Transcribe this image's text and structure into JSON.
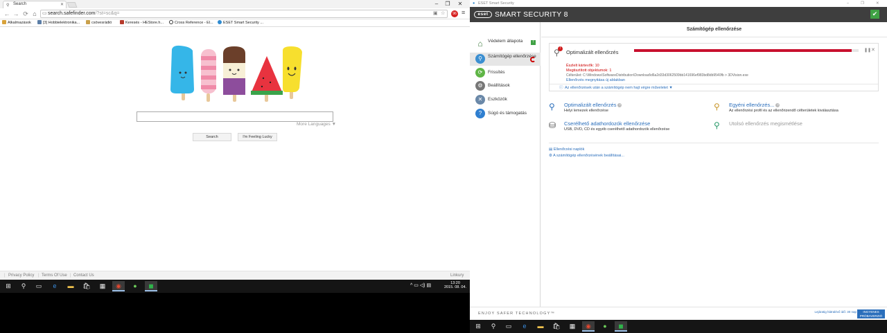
{
  "browser": {
    "tab_title": "Search",
    "url_host": "search.safefinder.com",
    "url_path": "/?st=sc&q=",
    "bookmarks": [
      "Alkalmazások",
      "[3] Hobbielektronika...",
      "csövesrádió",
      "Keresés - HEStore.h...",
      "Cross Reference - El...",
      "ESET Smart Security ..."
    ],
    "ext_badge": "96",
    "more_languages": "More Languages ▼",
    "search_button": "Search",
    "lucky_button": "I'm Feeling Lucky",
    "footer_links": [
      "Privacy Policy",
      "Terms Of Use",
      "Contact Us"
    ],
    "footer_right": "Linkury"
  },
  "taskbar_left": {
    "time": "13:20",
    "date": "2015. 08. 04."
  },
  "eset": {
    "titlebar": "ESET Smart Security",
    "logo": "eset",
    "product": "SMART SECURITY 8",
    "sidebar": [
      {
        "label": "Védelem állapota",
        "icon": "home-icon",
        "badge": "!"
      },
      {
        "label": "Számítógép ellenőrzése",
        "icon": "magnifier-icon"
      },
      {
        "label": "Frissítés",
        "icon": "refresh-icon"
      },
      {
        "label": "Beállítások",
        "icon": "gear-icon"
      },
      {
        "label": "Eszközök",
        "icon": "tools-icon"
      },
      {
        "label": "Súgó és támogatás",
        "icon": "help-icon"
      }
    ],
    "main_title": "Számítógép ellenőrzése",
    "scan": {
      "title": "Optimalizált ellenőrzés",
      "progress": 0.97,
      "detected": "Észlelt kártevők: 10",
      "scanned": "Megtisztított objektumok: 1",
      "target": "Célterület: C:\\Windows\\SoftwareDistribution\\Download\\d6a2d33d3062509bb141696ef983bd8db9540fb > 3DVision.exe",
      "open_window": "Ellenőrzés megnyitása új ablakban",
      "after_scan": "Az ellenőrzések után a számítógép nem hajt végre műveletet ▼"
    },
    "options": [
      {
        "title": "Optimalizált ellenőrzés",
        "desc": "Helyi lemezek ellenőrzése"
      },
      {
        "title": "Egyéni ellenőrzés...",
        "desc": "Az ellenőrzési profil és az ellenőrizendő célterületek kiválasztása"
      },
      {
        "title": "Cserélhető adathordozók ellenőrzése",
        "desc": "USB, DVD, CD és egyéb cserélhető adathordozók ellenőrzése"
      },
      {
        "title": "Utolsó ellenőrzés megismétlése",
        "desc": ""
      }
    ],
    "links": [
      "Ellenőrzési naplók",
      "A számítógép ellenőrzésének beállításai..."
    ],
    "footer_tagline": "ENJOY SAFER TECHNOLOGY™",
    "license_text": "Lejáratig hátralévő idő: 30 nap",
    "trial_button": "INGYENES PRÓBAVERZIÓ",
    "colors": {
      "accent": "#2a6ebb",
      "progress": "#c8102e",
      "ok": "#3fa144",
      "header": "#3e3e3e"
    }
  }
}
